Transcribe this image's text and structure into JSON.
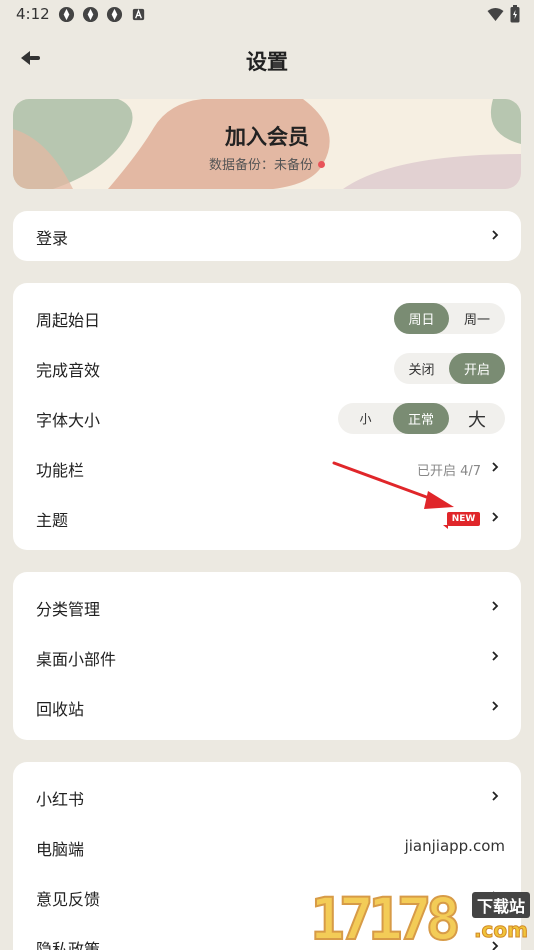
{
  "status_bar": {
    "time": "4:12",
    "icons": [
      "app-icon",
      "app-icon",
      "app-icon",
      "a-icon"
    ],
    "right_icons": [
      "wifi-icon",
      "battery-icon"
    ]
  },
  "header": {
    "title": "设置",
    "back_icon": "back-arrow-icon"
  },
  "member": {
    "title": "加入会员",
    "subtitle": "数据备份：未备份",
    "colors": {
      "accent": "#e8545a"
    }
  },
  "login": {
    "label": "登录"
  },
  "preferences": {
    "week_start": {
      "label": "周起始日",
      "options": [
        "周日",
        "周一"
      ],
      "selected": "周日"
    },
    "sound": {
      "label": "完成音效",
      "options": [
        "关闭",
        "开启"
      ],
      "selected": "开启"
    },
    "font_size": {
      "label": "字体大小",
      "options": [
        "小",
        "正常",
        "大"
      ],
      "selected": "正常"
    },
    "toolbar": {
      "label": "功能栏",
      "value": "已开启 4/7"
    },
    "theme": {
      "label": "主题",
      "badge": "NEW"
    }
  },
  "manage": {
    "items": [
      {
        "label": "分类管理"
      },
      {
        "label": "桌面小部件"
      },
      {
        "label": "回收站"
      }
    ]
  },
  "more": {
    "items": [
      {
        "label": "小红书"
      },
      {
        "label": "电脑端",
        "value": "jianjiapp.com"
      },
      {
        "label": "意见反馈"
      },
      {
        "label": "隐私政策"
      }
    ]
  },
  "watermark": {
    "number": "17178",
    "text": "下载站",
    "domain": ".com"
  },
  "colors": {
    "background": "#ece9e1",
    "accent_green": "#7a8c73",
    "badge_red": "#e0262a"
  }
}
